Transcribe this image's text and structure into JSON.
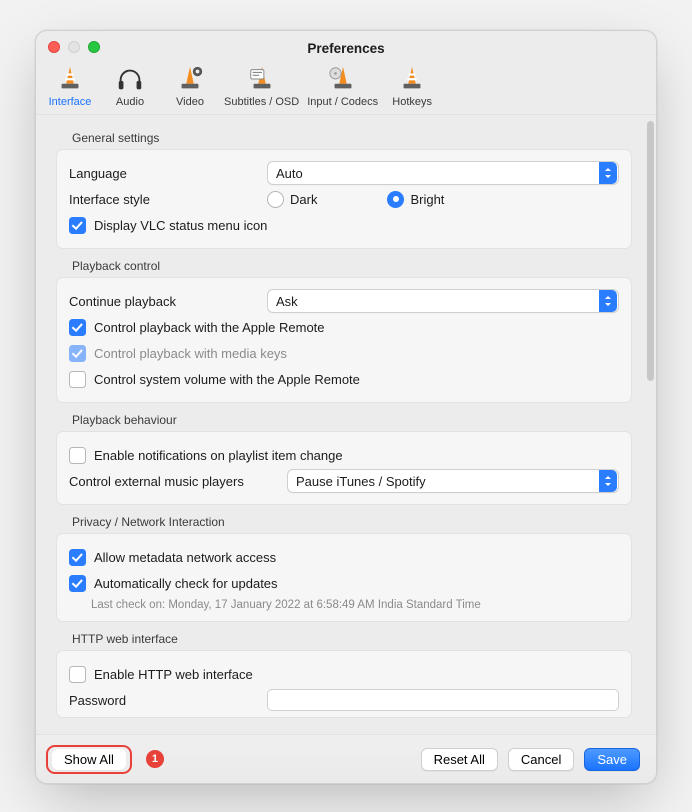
{
  "window": {
    "title": "Preferences"
  },
  "toolbar": {
    "items": [
      {
        "id": "interface",
        "label": "Interface",
        "active": true
      },
      {
        "id": "audio",
        "label": "Audio"
      },
      {
        "id": "video",
        "label": "Video"
      },
      {
        "id": "subtitles",
        "label": "Subtitles / OSD"
      },
      {
        "id": "input",
        "label": "Input / Codecs"
      },
      {
        "id": "hotkeys",
        "label": "Hotkeys"
      }
    ]
  },
  "sections": {
    "general": {
      "title": "General settings",
      "language_label": "Language",
      "language_value": "Auto",
      "style_label": "Interface style",
      "style_options": {
        "dark": "Dark",
        "bright": "Bright"
      },
      "style_selected": "bright",
      "status_menu_label": "Display VLC status menu icon",
      "status_menu_checked": true
    },
    "playback_control": {
      "title": "Playback control",
      "continue_label": "Continue playback",
      "continue_value": "Ask",
      "apple_remote_label": "Control playback with the Apple Remote",
      "apple_remote_checked": true,
      "media_keys_label": "Control playback with media keys",
      "media_keys_checked": true,
      "media_keys_disabled": true,
      "sys_volume_label": "Control system volume with the Apple Remote",
      "sys_volume_checked": false
    },
    "playback_behaviour": {
      "title": "Playback behaviour",
      "notify_label": "Enable notifications on playlist item change",
      "notify_checked": false,
      "ext_players_label": "Control external music players",
      "ext_players_value": "Pause iTunes / Spotify"
    },
    "privacy": {
      "title": "Privacy / Network Interaction",
      "metadata_label": "Allow metadata network access",
      "metadata_checked": true,
      "updates_label": "Automatically check for updates",
      "updates_checked": true,
      "last_check": "Last check on: Monday, 17 January 2022 at 6:58:49 AM India Standard Time"
    },
    "http": {
      "title": "HTTP web interface",
      "enable_label": "Enable HTTP web interface",
      "enable_checked": false,
      "password_label": "Password"
    }
  },
  "footer": {
    "show_all": "Show All",
    "reset_all": "Reset All",
    "cancel": "Cancel",
    "save": "Save",
    "callout": "1"
  }
}
